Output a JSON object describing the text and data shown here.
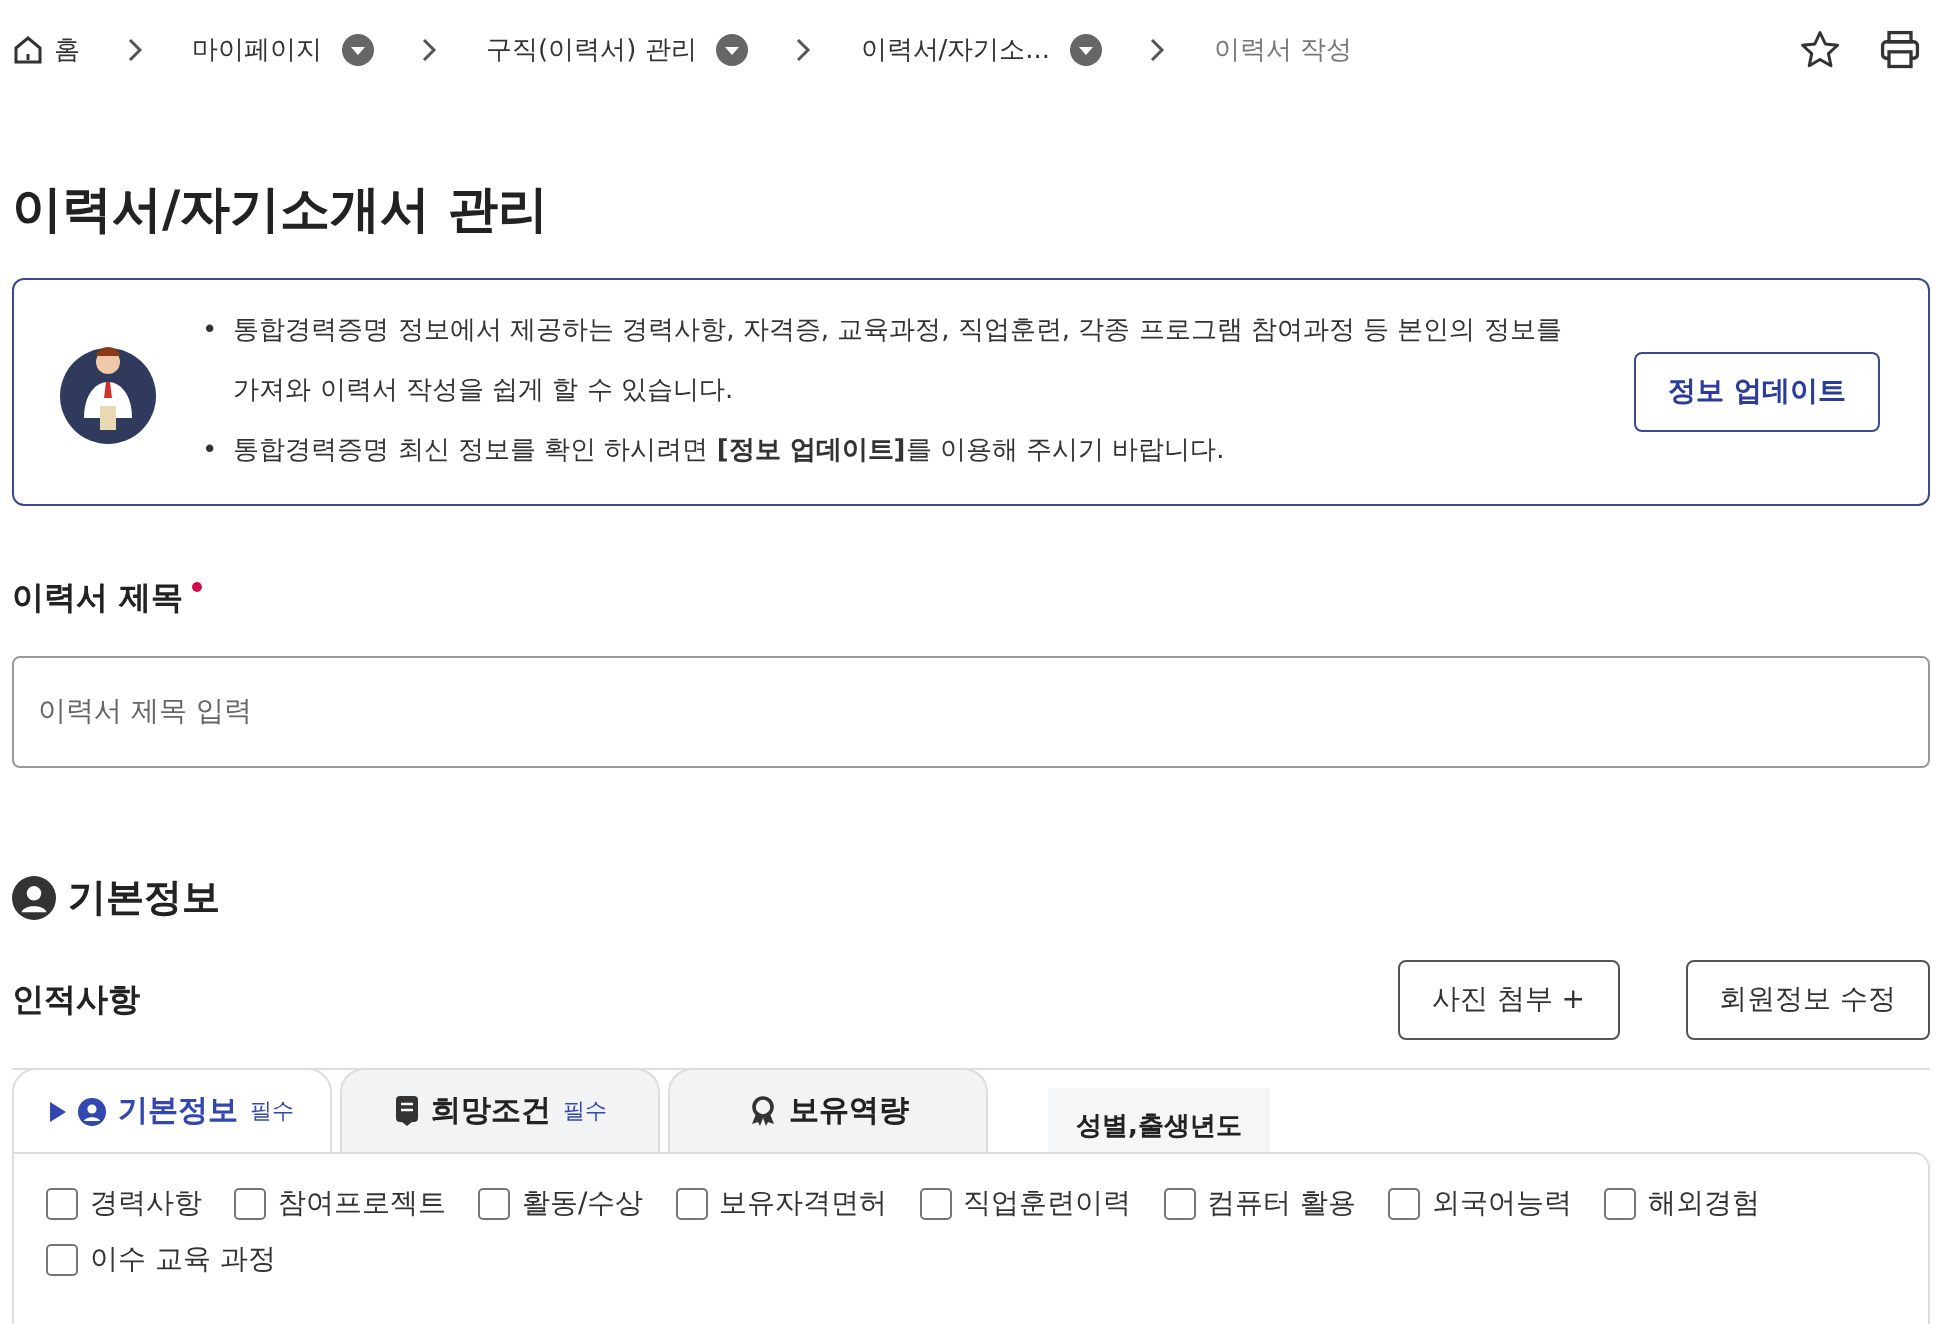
{
  "breadcrumb": [
    {
      "label": "홈",
      "kind": "home",
      "dropdown": false
    },
    {
      "label": "마이페이지",
      "kind": "link",
      "dropdown": true
    },
    {
      "label": "구직(이력서) 관리",
      "kind": "link",
      "dropdown": true
    },
    {
      "label": "이력서/자기소...",
      "kind": "link",
      "dropdown": true
    },
    {
      "label": "이력서 작성",
      "kind": "current",
      "dropdown": false
    }
  ],
  "title": "이력서/자기소개서 관리",
  "notice": {
    "bullets": [
      {
        "marker": "•",
        "text": "통합경력증명 정보에서 제공하는 경력사항, 자격증, 교육과정, 직업훈련, 각종 프로그램 참여과정 등 본인의 정보를 가져와 이력서 작성을 쉽게 할 수 있습니다."
      },
      {
        "marker": "•",
        "text": "통합경력증명 최신 정보를 확인 하시려면 **[정보 업데이트]**를 이용해 주시기 바랍니다."
      }
    ],
    "button": "정보 업데이트"
  },
  "resume_title": {
    "label": "이력서 제목",
    "required": true,
    "placeholder": "이력서 제목 입력"
  },
  "section": {
    "title": "기본정보",
    "subtitle": "인적사항",
    "buttons": [
      "사진 첨부 +",
      "회원정보 수정"
    ]
  },
  "tabs": [
    {
      "label": "기본정보",
      "badge": "필수",
      "kind": "person",
      "selected": true
    },
    {
      "label": "희망조건",
      "badge": "필수",
      "kind": "doc",
      "selected": false
    },
    {
      "label": "보유역량",
      "kind": "medal",
      "selected": false
    }
  ],
  "behind_label": "성별,출생년도",
  "options": [
    {
      "label": "경력사항",
      "checked": false
    },
    {
      "label": "참여프로젝트",
      "checked": false
    },
    {
      "label": "활동/수상",
      "checked": false
    },
    {
      "label": "보유자격면허",
      "checked": false
    },
    {
      "label": "직업훈련이력",
      "checked": false
    },
    {
      "label": "컴퓨터 활용",
      "checked": false
    },
    {
      "label": "외국어능력",
      "checked": false
    },
    {
      "label": "해외경험",
      "checked": false
    },
    {
      "label": "이수 교육 과정",
      "checked": false
    }
  ]
}
